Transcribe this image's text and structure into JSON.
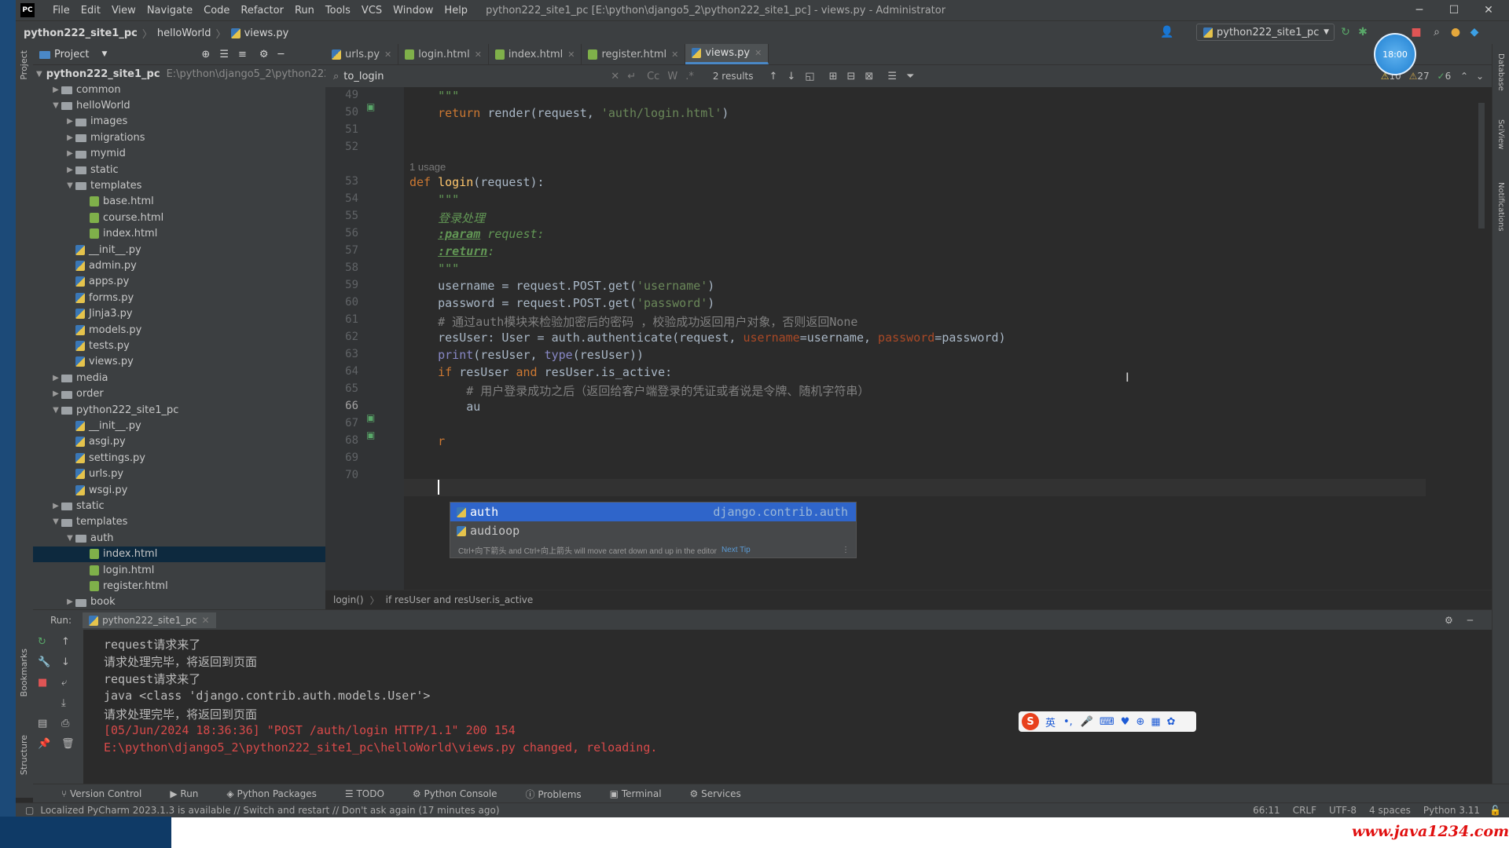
{
  "window": {
    "app_icon": "PC",
    "menu": [
      "File",
      "Edit",
      "View",
      "Navigate",
      "Code",
      "Refactor",
      "Run",
      "Tools",
      "VCS",
      "Window",
      "Help"
    ],
    "title": "python222_site1_pc [E:\\python\\django5_2\\python222_site1_pc] - views.py - Administrator"
  },
  "navbar": {
    "crumbs": [
      "python222_site1_pc",
      "helloWorld",
      "views.py"
    ],
    "run_config": "python222_site1_pc"
  },
  "avatar_time": "18:00",
  "project": {
    "title": "Project",
    "root": "python222_site1_pc",
    "root_path": "E:\\python\\django5_2\\python222",
    "tree": [
      {
        "label": "common",
        "type": "folder",
        "depth": 1,
        "arrow": "▶"
      },
      {
        "label": "helloWorld",
        "type": "folder",
        "depth": 1,
        "arrow": "▼"
      },
      {
        "label": "images",
        "type": "folder",
        "depth": 2,
        "arrow": "▶"
      },
      {
        "label": "migrations",
        "type": "folder",
        "depth": 2,
        "arrow": "▶"
      },
      {
        "label": "mymid",
        "type": "folder",
        "depth": 2,
        "arrow": "▶"
      },
      {
        "label": "static",
        "type": "folder",
        "depth": 2,
        "arrow": "▶"
      },
      {
        "label": "templates",
        "type": "folder",
        "depth": 2,
        "arrow": "▼"
      },
      {
        "label": "base.html",
        "type": "html",
        "depth": 3,
        "arrow": ""
      },
      {
        "label": "course.html",
        "type": "html",
        "depth": 3,
        "arrow": ""
      },
      {
        "label": "index.html",
        "type": "html",
        "depth": 3,
        "arrow": ""
      },
      {
        "label": "__init__.py",
        "type": "py",
        "depth": 2,
        "arrow": ""
      },
      {
        "label": "admin.py",
        "type": "py",
        "depth": 2,
        "arrow": ""
      },
      {
        "label": "apps.py",
        "type": "py",
        "depth": 2,
        "arrow": ""
      },
      {
        "label": "forms.py",
        "type": "py",
        "depth": 2,
        "arrow": ""
      },
      {
        "label": "Jinja3.py",
        "type": "py",
        "depth": 2,
        "arrow": ""
      },
      {
        "label": "models.py",
        "type": "py",
        "depth": 2,
        "arrow": ""
      },
      {
        "label": "tests.py",
        "type": "py",
        "depth": 2,
        "arrow": ""
      },
      {
        "label": "views.py",
        "type": "py",
        "depth": 2,
        "arrow": ""
      },
      {
        "label": "media",
        "type": "folder",
        "depth": 1,
        "arrow": "▶"
      },
      {
        "label": "order",
        "type": "folder",
        "depth": 1,
        "arrow": "▶"
      },
      {
        "label": "python222_site1_pc",
        "type": "folder",
        "depth": 1,
        "arrow": "▼"
      },
      {
        "label": "__init__.py",
        "type": "py",
        "depth": 2,
        "arrow": ""
      },
      {
        "label": "asgi.py",
        "type": "py",
        "depth": 2,
        "arrow": ""
      },
      {
        "label": "settings.py",
        "type": "py",
        "depth": 2,
        "arrow": ""
      },
      {
        "label": "urls.py",
        "type": "py",
        "depth": 2,
        "arrow": ""
      },
      {
        "label": "wsgi.py",
        "type": "py",
        "depth": 2,
        "arrow": ""
      },
      {
        "label": "static",
        "type": "folder",
        "depth": 1,
        "arrow": "▶"
      },
      {
        "label": "templates",
        "type": "folder",
        "depth": 1,
        "arrow": "▼"
      },
      {
        "label": "auth",
        "type": "folder",
        "depth": 2,
        "arrow": "▼"
      },
      {
        "label": "index.html",
        "type": "html",
        "depth": 3,
        "arrow": "",
        "selected": true
      },
      {
        "label": "login.html",
        "type": "html",
        "depth": 3,
        "arrow": ""
      },
      {
        "label": "register.html",
        "type": "html",
        "depth": 3,
        "arrow": ""
      },
      {
        "label": "book",
        "type": "folder",
        "depth": 2,
        "arrow": "▶"
      }
    ]
  },
  "tabs": [
    {
      "label": "urls.py",
      "type": "py",
      "active": false
    },
    {
      "label": "login.html",
      "type": "html",
      "active": false
    },
    {
      "label": "index.html",
      "type": "html",
      "active": false
    },
    {
      "label": "register.html",
      "type": "html",
      "active": false
    },
    {
      "label": "views.py",
      "type": "py",
      "active": true
    }
  ],
  "find": {
    "query": "to_login",
    "results": "2 results",
    "match_case": "Cc",
    "words": "W"
  },
  "inspections": {
    "warnings": "10",
    "weak_warnings": "27",
    "ok": "6"
  },
  "editor": {
    "usage_hint": "1 usage",
    "lines": [
      {
        "n": "49",
        "html": "    <span class=\"doc\">\"\"\"</span>"
      },
      {
        "n": "50",
        "html": "    <span class=\"kw\">return</span> render(request, <span class=\"str\">'auth/login.html'</span>)"
      },
      {
        "n": "51",
        "html": ""
      },
      {
        "n": "52",
        "html": ""
      },
      {
        "n": "53",
        "html": "<span class=\"kw\">def</span> <span class=\"fn\">login</span>(request):"
      },
      {
        "n": "54",
        "html": "    <span class=\"doc\">\"\"\"</span>"
      },
      {
        "n": "55",
        "html": "    <span class=\"doc\">登录处理</span>"
      },
      {
        "n": "56",
        "html": "    <span class=\"doctag\">:param</span><span class=\"doc\"> request:</span>"
      },
      {
        "n": "57",
        "html": "    <span class=\"doctag\">:return</span><span class=\"doc\">:</span>"
      },
      {
        "n": "58",
        "html": "    <span class=\"doc\">\"\"\"</span>"
      },
      {
        "n": "59",
        "html": "    username = request.POST.get(<span class=\"str\">'username'</span>)"
      },
      {
        "n": "60",
        "html": "    password = request.POST.get(<span class=\"str\">'password'</span>)"
      },
      {
        "n": "61",
        "html": "    <span class=\"cmt\"># 通过auth模块来检验加密后的密码 ，校验成功返回用户对象，否则返回None</span>"
      },
      {
        "n": "62",
        "html": "    resUser: User = auth.authenticate(request, <span class=\"param\">username</span>=username, <span class=\"param\">password</span>=password)"
      },
      {
        "n": "63",
        "html": "    <span class=\"fn\" style=\"color:#8888c6\">print</span>(resUser, <span style=\"color:#8888c6\">type</span>(resUser))"
      },
      {
        "n": "64",
        "html": "    <span class=\"kw\">if</span> resUser <span class=\"kw\">and</span> resUser.is_active:"
      },
      {
        "n": "65",
        "html": "        <span class=\"cmt\"># 用户登录成功之后（返回给客户端登录的凭证或者说是令牌、随机字符串）</span>"
      },
      {
        "n": "66",
        "html": "        au"
      },
      {
        "n": "67",
        "html": ""
      },
      {
        "n": "68",
        "html": "    <span class=\"kw\">r</span>"
      },
      {
        "n": "69",
        "html": ""
      },
      {
        "n": "70",
        "html": ""
      }
    ]
  },
  "completion": {
    "items": [
      {
        "name": "auth",
        "hint": "django.contrib.auth"
      },
      {
        "name": "audioop",
        "hint": ""
      }
    ],
    "tip": "Ctrl+向下箭头 and Ctrl+向上箭头 will move caret down and up in the editor",
    "next_tip": "Next Tip"
  },
  "code_breadcrumb": [
    "login()",
    "if resUser and resUser.is_active"
  ],
  "run": {
    "label": "Run:",
    "tab": "python222_site1_pc",
    "output": [
      {
        "text": "request请求来了",
        "color": "#bbbbbb"
      },
      {
        "text": "请求处理完毕，将返回到页面",
        "color": "#bbbbbb"
      },
      {
        "text": "request请求来了",
        "color": "#bbbbbb"
      },
      {
        "text": "java <class 'django.contrib.auth.models.User'>",
        "color": "#bbbbbb"
      },
      {
        "text": "请求处理完毕，将返回到页面",
        "color": "#bbbbbb"
      },
      {
        "text": "[05/Jun/2024 18:36:36] \"POST /auth/login HTTP/1.1\" 200 154",
        "color": "#d94a4a"
      },
      {
        "text": "E:\\python\\django5_2\\python222_site1_pc\\helloWorld\\views.py changed, reloading.",
        "color": "#d94a4a"
      }
    ]
  },
  "bottom_tools": [
    "Version Control",
    "Run",
    "Python Packages",
    "TODO",
    "Python Console",
    "Problems",
    "Terminal",
    "Services"
  ],
  "status": {
    "message": "Localized PyCharm 2023.1.3 is available // Switch and restart // Don't ask again (17 minutes ago)",
    "position": "66:11",
    "line_sep": "CRLF",
    "encoding": "UTF-8",
    "indent": "4 spaces",
    "interpreter": "Python 3.11"
  },
  "side_labels": {
    "left": [
      "Project",
      "Bookmarks",
      "Structure"
    ],
    "right": [
      "Database",
      "SciView",
      "Notifications"
    ]
  },
  "ime": {
    "logo": "S",
    "lang": "英"
  },
  "watermark": "www.java1234.com"
}
